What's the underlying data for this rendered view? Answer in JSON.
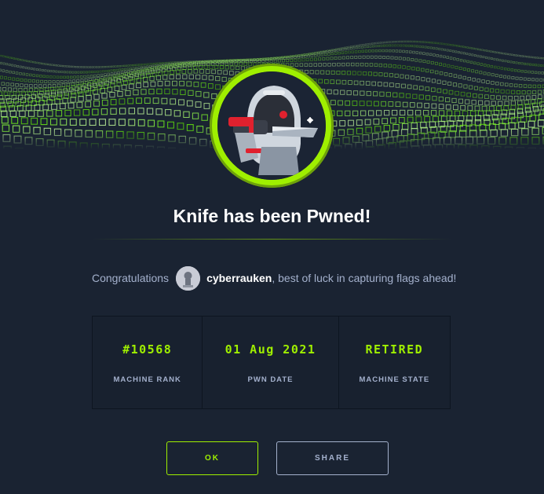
{
  "colors": {
    "background": "#1a2332",
    "accent": "#9fef00",
    "text": "#a4b1cd",
    "heading": "#ffffff"
  },
  "banner": {
    "icon": "green-cube-wave-icon"
  },
  "machine": {
    "avatar_icon": "robot-knife-icon",
    "title": "Knife has been Pwned!"
  },
  "congrats": {
    "prefix": "Congratulations",
    "avatar_icon": "user-avatar-icon",
    "username": "cyberrauken",
    "suffix": ", best of luck in capturing flags ahead!"
  },
  "stats": [
    {
      "value": "#10568",
      "label": "MACHINE RANK"
    },
    {
      "value": "01 Aug 2021",
      "label": "PWN DATE"
    },
    {
      "value": "RETIRED",
      "label": "MACHINE STATE"
    }
  ],
  "buttons": {
    "ok": "OK",
    "share": "SHARE"
  }
}
